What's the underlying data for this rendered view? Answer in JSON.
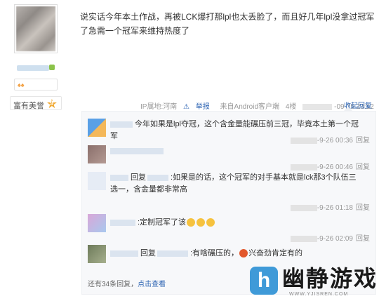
{
  "post": {
    "content": "说实话今年本土作战，再被LCK爆打那lpl也太丢脸了，而且好几年lpl没拿过冠军了急需一个冠军来维持热度了",
    "ip_location": "IP属地:河南",
    "report": "举报",
    "client": "来自Android客户端",
    "floor": "4楼",
    "time": "-09-25 23:12",
    "fold_reply": "收起回复"
  },
  "author": {
    "honor_label": "富有美誉",
    "honor_level": "9"
  },
  "replies": [
    {
      "text": "今年如果是lpl夺冠，这个含金量能碾压前三冠，毕竟本土第一个冠军",
      "time": "-9-26 00:36",
      "reply_label": "回复"
    },
    {
      "text": "",
      "time": "-9-26 00:46",
      "reply_label": "回复"
    },
    {
      "text": "回复",
      "text2": ":如果是的话，这个冠军的对手基本就是lck那3个队伍三选一，含金量都非常高",
      "time": "-9-26 01:18",
      "reply_label": "回复"
    },
    {
      "text": ":定制冠军了该",
      "time": "-9-26 02:09",
      "reply_label": "回复"
    },
    {
      "text": "回复",
      "text2": ":有啥碾压的，",
      "text3": "兴奋劲肯定有的",
      "time": "",
      "reply_label": ""
    }
  ],
  "more": {
    "count_text": "还有34条回复，",
    "link": "点击查看"
  },
  "watermark": {
    "brand": "幽静游戏",
    "url": "WWW.YJISREN.COM"
  },
  "colors": {
    "link": "#2d64b3",
    "brand": "#3f9ad8"
  }
}
